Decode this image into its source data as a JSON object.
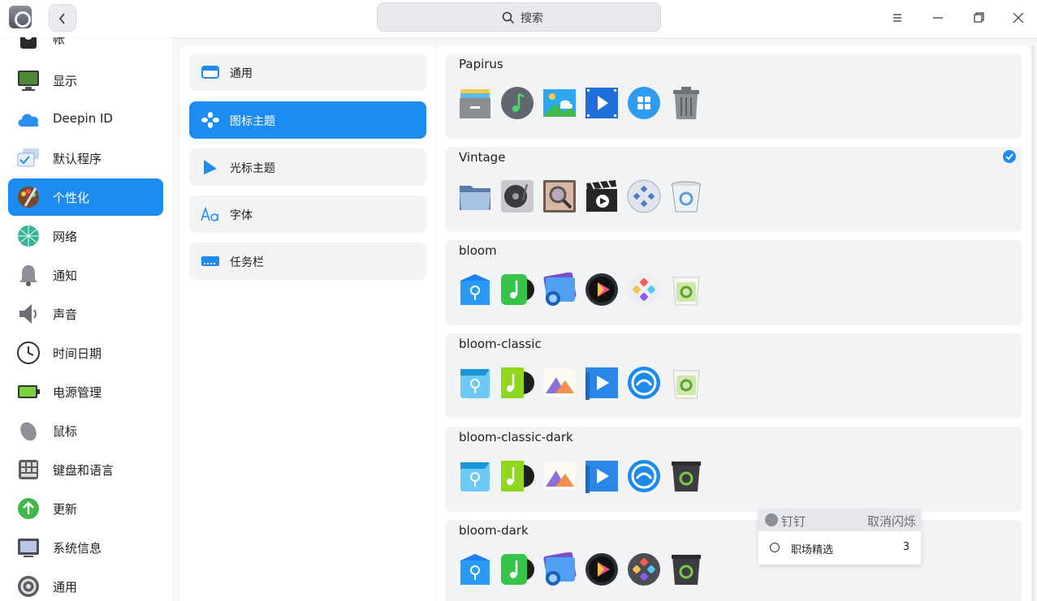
{
  "titlebar": {
    "search_placeholder": "搜索",
    "back_icon": "chevron-left-icon",
    "menu_icon": "hamburger-menu-icon",
    "minimize_icon": "minimize-icon",
    "maximize_icon": "maximize-icon",
    "close_icon": "close-icon"
  },
  "sidebar": {
    "items": [
      {
        "label": "帐",
        "icon": "accounts-icon"
      },
      {
        "label": "显示",
        "icon": "display-icon"
      },
      {
        "label": "Deepin ID",
        "icon": "cloud-icon"
      },
      {
        "label": "默认程序",
        "icon": "default-apps-icon"
      },
      {
        "label": "个性化",
        "icon": "personalization-icon",
        "active": true
      },
      {
        "label": "网络",
        "icon": "network-icon"
      },
      {
        "label": "通知",
        "icon": "bell-icon"
      },
      {
        "label": "声音",
        "icon": "speaker-icon"
      },
      {
        "label": "时间日期",
        "icon": "clock-icon"
      },
      {
        "label": "电源管理",
        "icon": "battery-icon"
      },
      {
        "label": "鼠标",
        "icon": "mouse-icon"
      },
      {
        "label": "键盘和语言",
        "icon": "keyboard-icon"
      },
      {
        "label": "更新",
        "icon": "update-icon"
      },
      {
        "label": "系统信息",
        "icon": "system-info-icon"
      },
      {
        "label": "通用",
        "icon": "general-gear-icon"
      }
    ]
  },
  "submenu": {
    "items": [
      {
        "label": "通用",
        "icon": "window-icon"
      },
      {
        "label": "图标主题",
        "icon": "flower-icon",
        "active": true
      },
      {
        "label": "光标主题",
        "icon": "cursor-icon"
      },
      {
        "label": "字体",
        "icon": "font-icon"
      },
      {
        "label": "任务栏",
        "icon": "taskbar-icon"
      }
    ]
  },
  "themes": [
    {
      "name": "Papirus",
      "selected": false
    },
    {
      "name": "Vintage",
      "selected": true
    },
    {
      "name": "bloom",
      "selected": false
    },
    {
      "name": "bloom-classic",
      "selected": false
    },
    {
      "name": "bloom-classic-dark",
      "selected": false
    },
    {
      "name": "bloom-dark",
      "selected": false
    }
  ],
  "popup": {
    "title": "钉钉",
    "action": "取消闪烁",
    "item_label": "职场精选",
    "item_count": "3"
  },
  "colors": {
    "accent": "#1c8cf0"
  }
}
